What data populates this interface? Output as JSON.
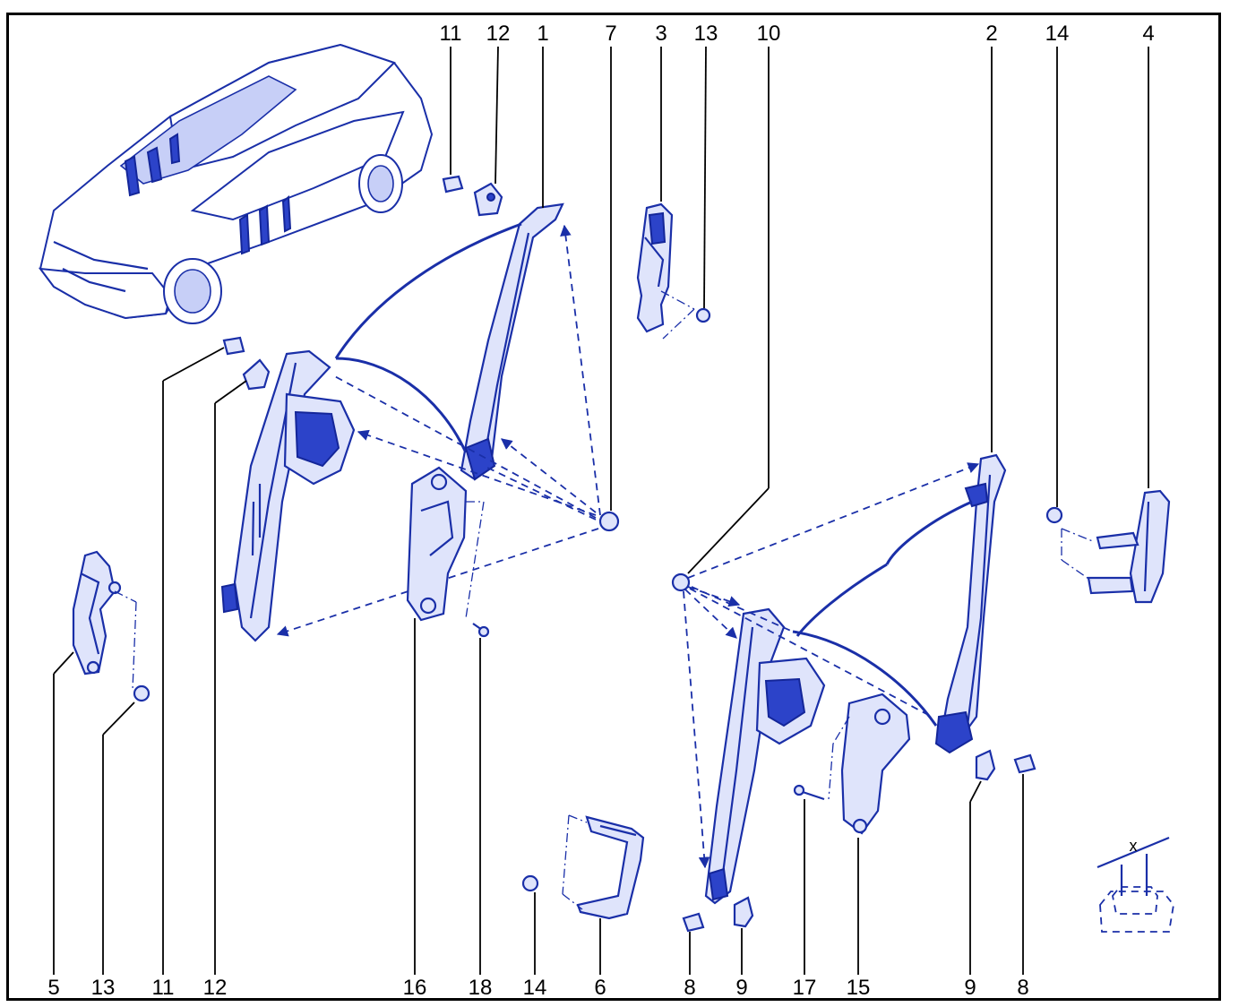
{
  "callouts": {
    "top": [
      "11",
      "12",
      "1",
      "7",
      "3",
      "13",
      "10",
      "2",
      "14",
      "4"
    ],
    "bottom": [
      "5",
      "13",
      "11",
      "12",
      "16",
      "18",
      "14",
      "6",
      "8",
      "9",
      "17",
      "15",
      "9",
      "8"
    ]
  },
  "detail": {
    "dimension_label": "x"
  },
  "colors": {
    "line": "#1a2fa8",
    "fill": "#dfe4fb",
    "dark": "#2c43c9",
    "border": "#000000"
  }
}
